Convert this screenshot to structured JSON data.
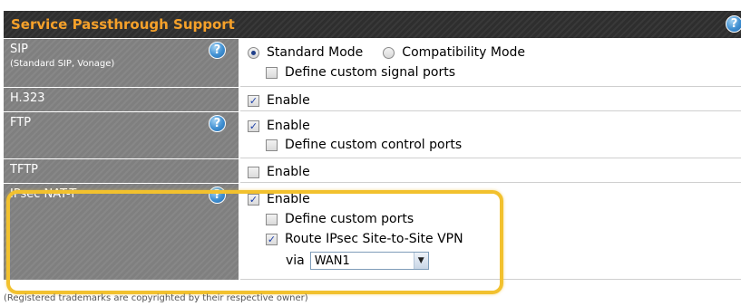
{
  "header": {
    "title": "Service Passthrough Support"
  },
  "rows": [
    {
      "label": "SIP",
      "sublabel": "(Standard SIP, Vonage)",
      "mode_options": [
        "Standard Mode",
        "Compatibility Mode"
      ],
      "selected_mode": "Standard Mode",
      "custom_ports_label": "Define custom signal ports",
      "custom_ports_checked": false
    },
    {
      "label": "H.323",
      "enable_label": "Enable",
      "enabled": true
    },
    {
      "label": "FTP",
      "enable_label": "Enable",
      "enabled": true,
      "custom_ports_label": "Define custom control ports",
      "custom_ports_checked": false
    },
    {
      "label": "TFTP",
      "enable_label": "Enable",
      "enabled": false
    },
    {
      "label": "IPsec NAT-T",
      "enable_label": "Enable",
      "enabled": true,
      "custom_ports_label": "Define custom ports",
      "custom_ports_checked": false,
      "route_label": "Route IPsec Site-to-Site VPN",
      "route_checked": true,
      "via_label": "via",
      "via_value": "WAN1"
    }
  ],
  "footnote": "(Registered trademarks are copyrighted by their respective owner)",
  "help_glyph": "?",
  "check_glyph": "✓",
  "dropdown_glyph": "▼",
  "colors": {
    "header_bg": "#2e2e2e",
    "header_text": "#f6a12a",
    "label_bg": "#7f7f7f",
    "highlight": "#f2c12e"
  }
}
